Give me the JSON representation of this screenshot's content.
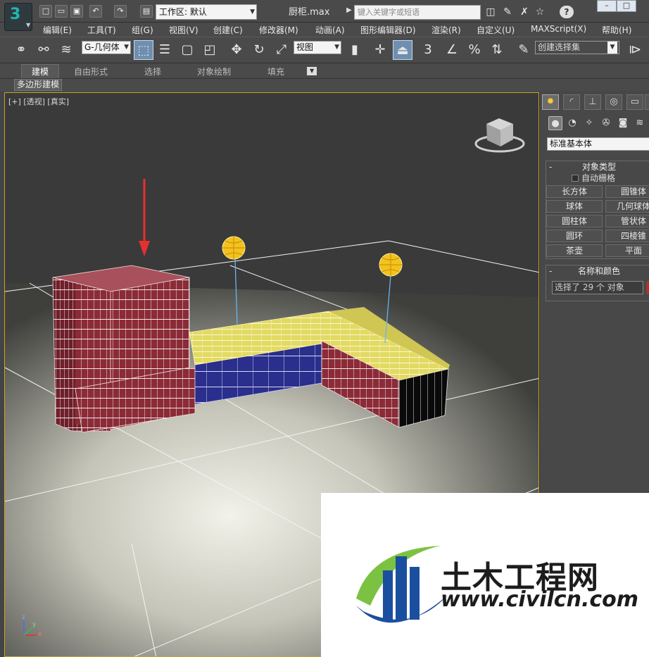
{
  "titlebar": {
    "workspace_label": "工作区: 默认",
    "doc_title": "厨柜.max",
    "search_placeholder": "键入关键字或短语",
    "help_label": "?"
  },
  "menu": {
    "items": [
      "编辑(E)",
      "工具(T)",
      "组(G)",
      "视图(V)",
      "创建(C)",
      "修改器(M)",
      "动画(A)",
      "图形编辑器(D)",
      "渲染(R)",
      "自定义(U)",
      "MAXScript(X)",
      "帮助(H)"
    ]
  },
  "toolbar": {
    "filter_value": "G-几何体",
    "ref_coord_value": "视图",
    "snap_label": "3",
    "selection_set_value": "创建选择集"
  },
  "ribbon": {
    "tabs": [
      "建模",
      "自由形式",
      "选择",
      "对象绘制",
      "填充"
    ],
    "active_tab": "建模",
    "sub_tab": "多边形建模"
  },
  "viewport": {
    "label_plus": "[+]",
    "label_view": "[透视]",
    "label_shading": "[真实]",
    "axis_x": "x",
    "axis_y": "y",
    "axis_z": "z",
    "colors": {
      "background": "#3a3a3a",
      "selected_cabinet": "#8a2a35",
      "counter_top": "#e8e06a",
      "blue_cabinet": "#2a2e8a",
      "light_gizmo": "#f2c21e",
      "arrow": "#e53030"
    }
  },
  "command_panel": {
    "category_value": "标准基本体",
    "object_type": {
      "title": "对象类型",
      "autogrid_label": "自动栅格",
      "buttons": [
        "长方体",
        "圆锥体",
        "球体",
        "几何球体",
        "圆柱体",
        "管状体",
        "圆环",
        "四棱锥",
        "茶壶",
        "平面"
      ]
    },
    "name_color": {
      "title": "名称和颜色",
      "selection_text": "选择了 29 个 对象",
      "swatch_color": "#d62020"
    }
  },
  "watermark": {
    "name": "土木工程网",
    "url": "www.civilcn.com"
  }
}
